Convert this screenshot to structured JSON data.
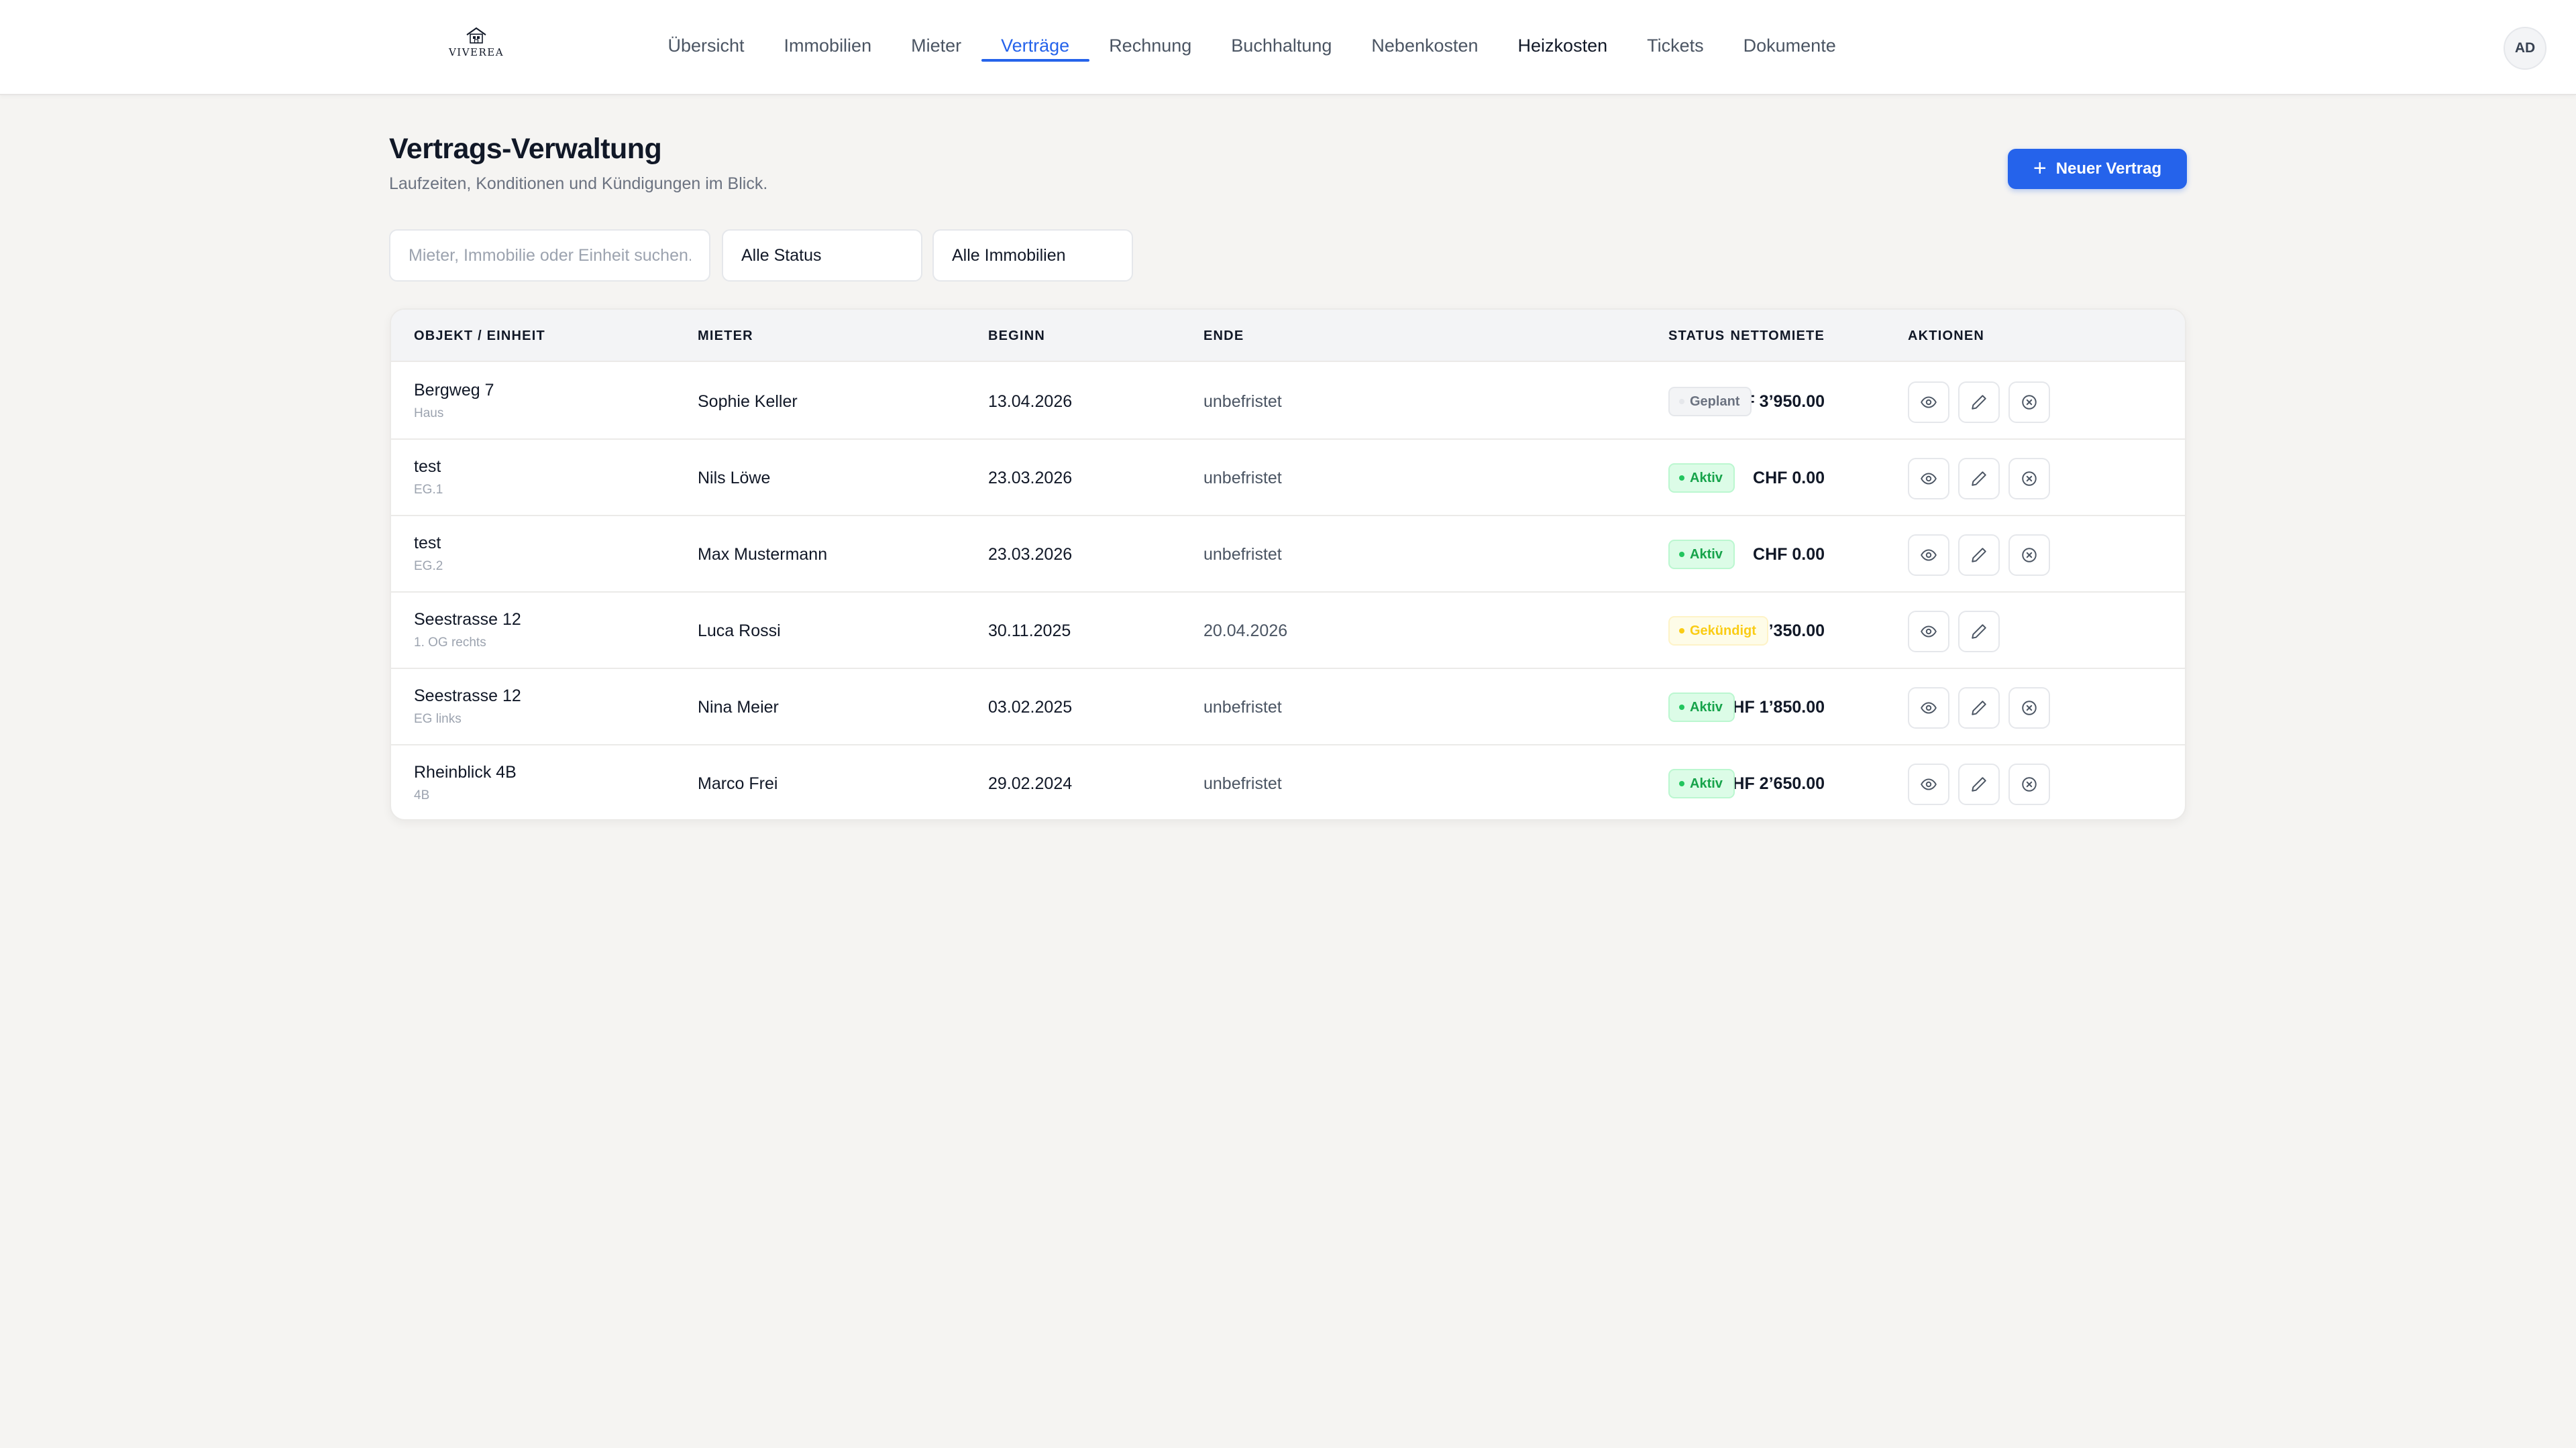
{
  "brand": {
    "name": "VIVEREA"
  },
  "nav": {
    "items": [
      {
        "label": "Übersicht",
        "state": "normal"
      },
      {
        "label": "Immobilien",
        "state": "normal"
      },
      {
        "label": "Mieter",
        "state": "normal"
      },
      {
        "label": "Verträge",
        "state": "active"
      },
      {
        "label": "Rechnung",
        "state": "normal"
      },
      {
        "label": "Buchhaltung",
        "state": "normal"
      },
      {
        "label": "Nebenkosten",
        "state": "normal"
      },
      {
        "label": "Heizkosten",
        "state": "strong"
      },
      {
        "label": "Tickets",
        "state": "normal"
      },
      {
        "label": "Dokumente",
        "state": "normal"
      }
    ],
    "avatar_initials": "AD"
  },
  "header": {
    "title": "Vertrags-Verwaltung",
    "subtitle": "Laufzeiten, Konditionen und Kündigungen im Blick.",
    "new_button_label": "Neuer Vertrag",
    "new_button_icon": "plus-icon"
  },
  "filters": {
    "search_placeholder": "Mieter, Immobilie oder Einheit suchen...",
    "search_value": "",
    "status_selected": "Alle Status",
    "property_selected": "Alle Immobilien"
  },
  "table": {
    "columns": {
      "object": "OBJEKT / EINHEIT",
      "tenant": "MIETER",
      "start": "BEGINN",
      "end": "ENDE",
      "rent": "NETTOMIETE",
      "status": "STATUS",
      "actions": "AKTIONEN"
    },
    "rows": [
      {
        "object": "Bergweg 7",
        "unit": "Haus",
        "tenant": "Sophie Keller",
        "start": "13.04.2026",
        "end": "unbefristet",
        "rent": "CHF 3’950.00",
        "status": "Geplant",
        "status_kind": "planned",
        "actions": [
          "eye-icon",
          "pencil-icon",
          "cancel-icon"
        ]
      },
      {
        "object": "test",
        "unit": "EG.1",
        "tenant": "Nils Löwe",
        "start": "23.03.2026",
        "end": "unbefristet",
        "rent": "CHF 0.00",
        "status": "Aktiv",
        "status_kind": "active",
        "actions": [
          "eye-icon",
          "pencil-icon",
          "cancel-icon"
        ]
      },
      {
        "object": "test",
        "unit": "EG.2",
        "tenant": "Max Mustermann",
        "start": "23.03.2026",
        "end": "unbefristet",
        "rent": "CHF 0.00",
        "status": "Aktiv",
        "status_kind": "active",
        "actions": [
          "eye-icon",
          "pencil-icon",
          "cancel-icon"
        ]
      },
      {
        "object": "Seestrasse 12",
        "unit": "1. OG rechts",
        "tenant": "Luca Rossi",
        "start": "30.11.2025",
        "end": "20.04.2026",
        "rent": "CHF 2’350.00",
        "status": "Gekündigt",
        "status_kind": "cancelled",
        "actions": [
          "eye-icon",
          "pencil-icon"
        ]
      },
      {
        "object": "Seestrasse 12",
        "unit": "EG links",
        "tenant": "Nina Meier",
        "start": "03.02.2025",
        "end": "unbefristet",
        "rent": "CHF 1’850.00",
        "status": "Aktiv",
        "status_kind": "active",
        "actions": [
          "eye-icon",
          "pencil-icon",
          "cancel-icon"
        ]
      },
      {
        "object": "Rheinblick 4B",
        "unit": "4B",
        "tenant": "Marco Frei",
        "start": "29.02.2024",
        "end": "unbefristet",
        "rent": "CHF 2’650.00",
        "status": "Aktiv",
        "status_kind": "active",
        "actions": [
          "eye-icon",
          "pencil-icon",
          "cancel-icon"
        ]
      }
    ]
  },
  "colors": {
    "accent": "#2563eb",
    "status_active": "#16a34a",
    "status_planned": "#6b7280",
    "status_cancelled": "#facc15",
    "page_background": "#f5f4f2"
  }
}
